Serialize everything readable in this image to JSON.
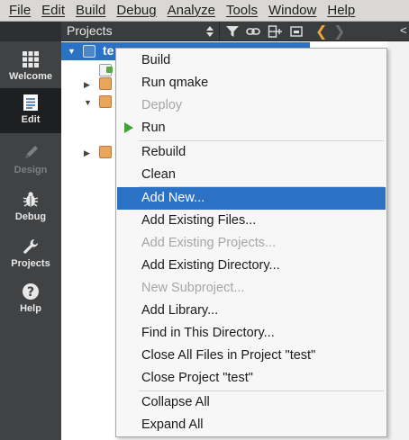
{
  "menubar": {
    "items": [
      "File",
      "Edit",
      "Build",
      "Debug",
      "Analyze",
      "Tools",
      "Window",
      "Help"
    ]
  },
  "modes": [
    {
      "label": "Welcome",
      "icon": "grid-icon",
      "state": "normal"
    },
    {
      "label": "Edit",
      "icon": "document-icon",
      "state": "active"
    },
    {
      "label": "Design",
      "icon": "pencil-icon",
      "state": "disabled"
    },
    {
      "label": "Debug",
      "icon": "bug-icon",
      "state": "normal"
    },
    {
      "label": "Projects",
      "icon": "wrench-icon",
      "state": "normal"
    },
    {
      "label": "Help",
      "icon": "question-icon",
      "state": "normal"
    }
  ],
  "projects_panel": {
    "title": "Projects",
    "tree_root_label": "te"
  },
  "editor_toolbar": {
    "crumb": "<"
  },
  "context_menu": {
    "items": [
      {
        "label": "Build",
        "state": "normal"
      },
      {
        "label": "Run qmake",
        "state": "normal"
      },
      {
        "label": "Deploy",
        "state": "disabled"
      },
      {
        "label": "Run",
        "state": "normal",
        "icon": "play-icon"
      },
      {
        "label": "Rebuild",
        "state": "normal"
      },
      {
        "label": "Clean",
        "state": "normal"
      },
      {
        "label": "Add New...",
        "state": "highlighted"
      },
      {
        "label": "Add Existing Files...",
        "state": "normal"
      },
      {
        "label": "Add Existing Projects...",
        "state": "disabled"
      },
      {
        "label": "Add Existing Directory...",
        "state": "normal"
      },
      {
        "label": "New Subproject...",
        "state": "disabled"
      },
      {
        "label": "Add Library...",
        "state": "normal"
      },
      {
        "label": "Find in This Directory...",
        "state": "normal"
      },
      {
        "label": "Close All Files in Project \"test\"",
        "state": "normal"
      },
      {
        "label": "Close Project \"test\"",
        "state": "normal"
      },
      {
        "label": "Collapse All",
        "state": "normal"
      },
      {
        "label": "Expand All",
        "state": "normal"
      }
    ]
  },
  "colors": {
    "selection": "#2b72c4",
    "run_green": "#3fa33a",
    "nav_arrow": "#e8a634"
  }
}
